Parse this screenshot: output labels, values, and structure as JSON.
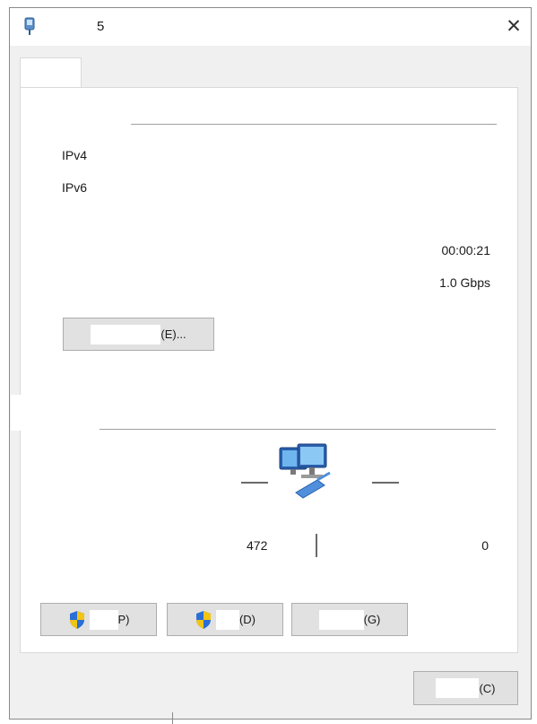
{
  "window": {
    "title": "5"
  },
  "connection": {
    "ipv4_label": "IPv4",
    "ipv6_label": "IPv6",
    "duration": "00:00:21",
    "speed": "1.0 Gbps",
    "details_button": "(E)..."
  },
  "activity": {
    "sent": "472",
    "received": "0"
  },
  "buttons": {
    "properties": "P)",
    "disable": "(D)",
    "diagnose": "(G)",
    "close": "(C)"
  },
  "icons": {
    "app": "network-adapter-icon",
    "close": "close-icon",
    "network": "network-computers-icon",
    "shield": "uac-shield-icon"
  },
  "colors": {
    "window_bg": "#f0f0f0",
    "panel_bg": "#ffffff",
    "button_bg": "#e1e1e1",
    "shield_blue": "#2a6fd6",
    "shield_yellow": "#f2c413"
  }
}
